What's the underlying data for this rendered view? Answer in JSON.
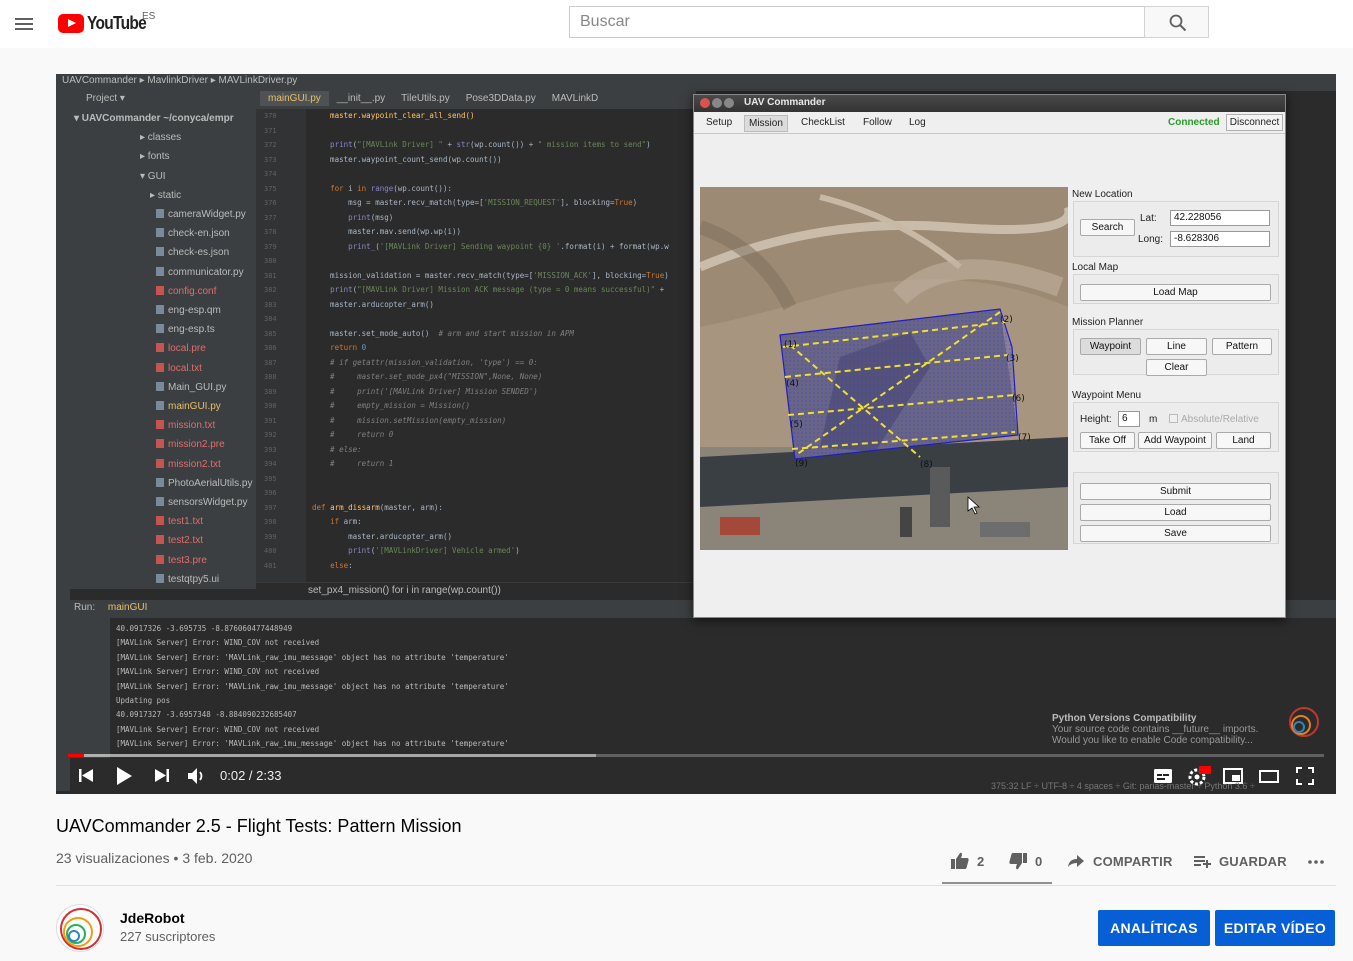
{
  "header": {
    "logo_text": "YouTube",
    "country_code": "ES",
    "search_placeholder": "Buscar"
  },
  "ide": {
    "topbar": "UAVCommander  ▸ MavlinkDriver  ▸ MAVLinkDriver.py",
    "project_label": "Project ▾",
    "tabs": [
      "mainGUI.py",
      "__init__.py",
      "TileUtils.py",
      "Pose3DData.py",
      "MAVLinkD"
    ],
    "tree": [
      {
        "text": "▾ UAVCommander  ~/conyca/empr",
        "kind": "root"
      },
      {
        "text": "▸ classes",
        "kind": "folder"
      },
      {
        "text": "▸ fonts",
        "kind": "folder"
      },
      {
        "text": "▾ GUI",
        "kind": "folder"
      },
      {
        "text": "▸ static",
        "kind": "subfolder"
      },
      {
        "text": "cameraWidget.py",
        "kind": "py"
      },
      {
        "text": "check-en.json",
        "kind": "file"
      },
      {
        "text": "check-es.json",
        "kind": "file"
      },
      {
        "text": "communicator.py",
        "kind": "py"
      },
      {
        "text": "config.conf",
        "kind": "red"
      },
      {
        "text": "eng-esp.qm",
        "kind": "file"
      },
      {
        "text": "eng-esp.ts",
        "kind": "file"
      },
      {
        "text": "local.pre",
        "kind": "red"
      },
      {
        "text": "local.txt",
        "kind": "red"
      },
      {
        "text": "Main_GUI.py",
        "kind": "py"
      },
      {
        "text": "mainGUI.py",
        "kind": "gold"
      },
      {
        "text": "mission.txt",
        "kind": "red"
      },
      {
        "text": "mission2.pre",
        "kind": "red"
      },
      {
        "text": "mission2.txt",
        "kind": "red"
      },
      {
        "text": "PhotoAerialUtils.py",
        "kind": "py"
      },
      {
        "text": "sensorsWidget.py",
        "kind": "py"
      },
      {
        "text": "test1.txt",
        "kind": "red"
      },
      {
        "text": "test2.txt",
        "kind": "red"
      },
      {
        "text": "test3.pre",
        "kind": "red"
      },
      {
        "text": "testqtpy5.ui",
        "kind": "file"
      }
    ],
    "breadcrumb": "set_px4_mission()    for i in range(wp.count())",
    "run_label": "Run:",
    "run_config": "mainGUI",
    "console": [
      "40.0917326 -3.695735 -8.876060477448949",
      "[MAVLink Server] Error: WIND_COV not received",
      "[MAVLink Server] Error: 'MAVLink_raw_imu_message' object has no attribute 'temperature'",
      "[MAVLink Server] Error: WIND_COV not received",
      "[MAVLink Server] Error: 'MAVLink_raw_imu_message' object has no attribute 'temperature'",
      "Updating pos",
      "40.0917327 -3.6957348 -8.884090232685407",
      "[MAVLink Server] Error: WIND_COV not received",
      "[MAVLink Server] Error: 'MAVLink_raw_imu_message' object has no attribute 'temperature'"
    ],
    "notification_title": "Python Versions Compatibility",
    "notification_body_1": "Your source code contains __future__ imports.",
    "notification_body_2": "Would you like to enable Code compatibility...",
    "status_right": "375:32  LF ÷  UTF-8 ÷  4 spaces ÷  Git: parias-master ÷  Python 3.6 ÷"
  },
  "uav": {
    "window_title": "UAV Commander",
    "tabs": [
      "Setup",
      "Mission",
      "CheckList",
      "Follow",
      "Log"
    ],
    "active_tab": "Mission",
    "status": "Connected",
    "disconnect_label": "Disconnect",
    "new_location": {
      "header": "New Location",
      "search_label": "Search",
      "lat_label": "Lat:",
      "lat_value": "42.228056",
      "long_label": "Long:",
      "long_value": "-8.628306"
    },
    "local_map": {
      "header": "Local Map",
      "load_label": "Load Map"
    },
    "mission_planner": {
      "header": "Mission Planner",
      "waypoint": "Waypoint",
      "line": "Line",
      "pattern": "Pattern",
      "clear": "Clear"
    },
    "waypoint_menu": {
      "header": "Waypoint Menu",
      "height_label": "Height:",
      "height_value": "6",
      "height_unit": "m",
      "absolute_relative": "Absolute/Relative",
      "takeoff": "Take Off",
      "add_waypoint": "Add Waypoint",
      "land": "Land"
    },
    "actions": {
      "submit": "Submit",
      "load": "Load",
      "save": "Save"
    },
    "waypoint_labels": [
      "(1)",
      "(2)",
      "(3)",
      "(4)",
      "(5)",
      "(6)",
      "(7)",
      "(8)",
      "(9)"
    ]
  },
  "player": {
    "time_current": "0:02",
    "time_total": "2:33",
    "progress_played": 0.013,
    "progress_buffered": 0.42
  },
  "video": {
    "title": "UAVCommander 2.5 - Flight Tests: Pattern Mission",
    "views": "23 visualizaciones",
    "date": "3 feb. 2020",
    "likes": "2",
    "dislikes": "0",
    "share_label": "COMPARTIR",
    "save_label": "GUARDAR"
  },
  "channel": {
    "name": "JdeRobot",
    "subscribers": "227 suscriptores",
    "analytics_label": "ANALÍTICAS",
    "edit_label": "EDITAR VÍDEO"
  },
  "colors": {
    "brand_red": "#ff0000",
    "button_blue": "#065fd4",
    "connected_green": "#2a9d2a"
  }
}
